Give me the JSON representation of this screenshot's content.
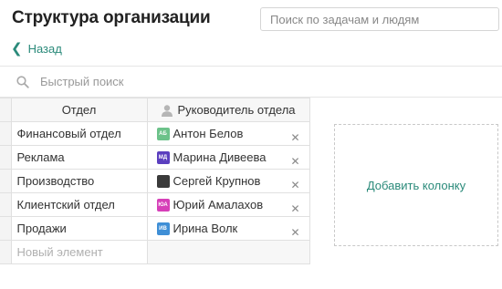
{
  "page_title": "Структура организации",
  "search": {
    "placeholder": "Поиск по задачам и людям"
  },
  "back_label": "Назад",
  "quick_search": {
    "placeholder": "Быстрый поиск"
  },
  "table": {
    "columns": [
      "Отдел",
      "Руководитель отдела"
    ],
    "rows": [
      {
        "department": "Финансовый отдел",
        "manager": "Антон Белов",
        "initials": "АБ",
        "avatar_color": "#6cc28a"
      },
      {
        "department": "Реклама",
        "manager": "Марина Дивеева",
        "initials": "МД",
        "avatar_color": "#5b3fbf"
      },
      {
        "department": "Производство",
        "manager": "Сергей Крупнов",
        "initials": "",
        "avatar_color": "#3a3a3a"
      },
      {
        "department": "Клиентский отдел",
        "manager": "Юрий Амалахов",
        "initials": "ЮА",
        "avatar_color": "#d63fb8"
      },
      {
        "department": "Продажи",
        "manager": "Ирина Волк",
        "initials": "ИВ",
        "avatar_color": "#3f8fd6"
      }
    ],
    "new_element_placeholder": "Новый элемент"
  },
  "add_column_label": "Добавить колонку",
  "colors": {
    "accent": "#2a8a7a"
  }
}
